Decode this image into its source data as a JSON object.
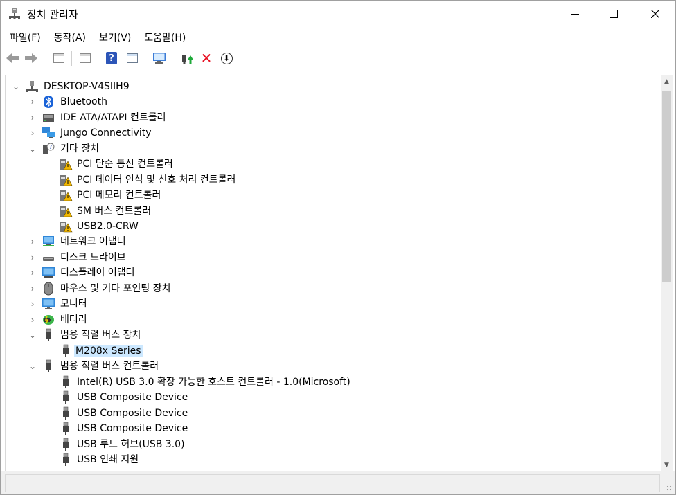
{
  "window": {
    "title": "장치 관리자"
  },
  "menu": [
    "파일(F)",
    "동작(A)",
    "보기(V)",
    "도움말(H)"
  ],
  "colors": {
    "selection": "#cce8ff",
    "warning": "#f2b700",
    "delete": "#e81123"
  },
  "tree": {
    "root": "DESKTOP-V4SIIH9",
    "categories": {
      "bluetooth": "Bluetooth",
      "ide": "IDE ATA/ATAPI 컨트롤러",
      "jungo": "Jungo Connectivity",
      "other": "기타 장치",
      "network": "네트워크 어댑터",
      "disk": "디스크 드라이브",
      "display": "디스플레이 어댑터",
      "mouse": "마우스 및 기타 포인팅 장치",
      "monitor": "모니터",
      "battery": "배터리",
      "usb_devices": "범용 직렬 버스 장치",
      "usb_controllers": "범용 직렬 버스 컨트롤러"
    },
    "other_children": [
      "PCI 단순 통신 컨트롤러",
      "PCI 데이터 인식 및 신호 처리 컨트롤러",
      "PCI 메모리 컨트롤러",
      "SM 버스 컨트롤러",
      "USB2.0-CRW"
    ],
    "usb_device_children": [
      "M208x Series"
    ],
    "usb_controller_children": [
      "Intel(R) USB 3.0 확장 가능한 호스트 컨트롤러 - 1.0(Microsoft)",
      "USB Composite Device",
      "USB Composite Device",
      "USB Composite Device",
      "USB 루트 허브(USB 3.0)",
      "USB 인쇄 지원"
    ]
  }
}
